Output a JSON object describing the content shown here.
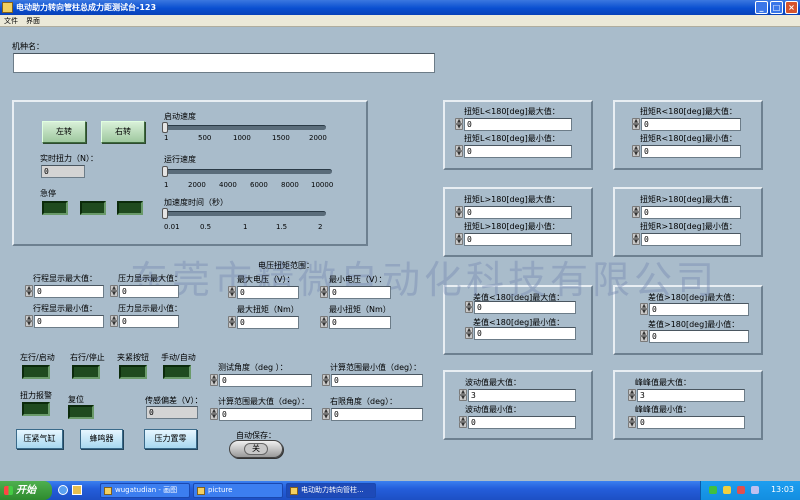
{
  "window": {
    "title": "电动助力转向管柱总成力距测试台-123"
  },
  "menu": [
    "文件",
    "界面"
  ],
  "machine": {
    "label": "机种名：",
    "value": ""
  },
  "control": {
    "left_btn": "左转",
    "right_btn": "右转",
    "torque_label": "实时扭力（N）：",
    "torque_value": "0",
    "estop_label": "急停",
    "start_speed": {
      "label": "启动速度",
      "ticks": [
        "1",
        "500",
        "1000",
        "1500",
        "2000"
      ]
    },
    "run_speed": {
      "label": "运行速度",
      "ticks": [
        "1",
        "2000",
        "4000",
        "6000",
        "8000",
        "10000"
      ]
    },
    "accel_time": {
      "label": "加速度时间（秒）",
      "ticks": [
        "0.01",
        "0.5",
        "1",
        "1.5",
        "2"
      ]
    }
  },
  "limits": [
    {
      "label": "扭矩L<180[deg]最大值：",
      "value": "0"
    },
    {
      "label": "扭矩L<180[deg]最小值：",
      "value": "0"
    },
    {
      "label": "扭矩R<180[deg]最大值：",
      "value": "0"
    },
    {
      "label": "扭矩R<180[deg]最小值：",
      "value": "0"
    },
    {
      "label": "扭矩L>180[deg]最大值：",
      "value": "0"
    },
    {
      "label": "扭矩L>180[deg]最小值：",
      "value": "0"
    },
    {
      "label": "扭矩R>180[deg]最大值：",
      "value": "0"
    },
    {
      "label": "扭矩R>180[deg]最小值：",
      "value": "0"
    },
    {
      "label": "差值<180[deg]最大值：",
      "value": "0"
    },
    {
      "label": "差值<180[deg]最小值：",
      "value": "0"
    },
    {
      "label": "差值>180[deg]最大值：",
      "value": "0"
    },
    {
      "label": "差值>180[deg]最小值：",
      "value": "0"
    },
    {
      "label": "波动值最大值：",
      "value": "3"
    },
    {
      "label": "波动值最小值：",
      "value": "0"
    },
    {
      "label": "峰峰值最大值：",
      "value": "3"
    },
    {
      "label": "峰峰值最小值：",
      "value": "0"
    }
  ],
  "display": [
    {
      "label": "行程显示最大值：",
      "value": "0"
    },
    {
      "label": "压力显示最大值：",
      "value": "0"
    },
    {
      "label": "行程显示最小值：",
      "value": "0"
    },
    {
      "label": "压力显示最小值：",
      "value": "0"
    }
  ],
  "range_title": "电压扭矩范围：",
  "range": [
    {
      "label": "最大电压（V）：",
      "value": "0"
    },
    {
      "label": "最小电压（V）：",
      "value": "0"
    },
    {
      "label": "最大扭矩（Nm）",
      "value": "0"
    },
    {
      "label": "最小扭矩（Nm）",
      "value": "0"
    }
  ],
  "indicators": [
    "左行/启动",
    "右行/停止",
    "夹紧按钮",
    "手动/自动",
    "扭力报警",
    "复位"
  ],
  "angles": [
    {
      "label": "测试角度（deg ）：",
      "value": "0"
    },
    {
      "label": "计算范围最小值（deg）：",
      "value": "0"
    },
    {
      "label": "计算范围最大值（deg）：",
      "value": "0"
    },
    {
      "label": "右限角度（deg）：",
      "value": "0"
    }
  ],
  "sensor": {
    "label": "传感偏差（V）：",
    "value": "0"
  },
  "buttons": {
    "cylinder": "压紧气缸",
    "buzzer": "蜂鸣器",
    "zero": "压力置零"
  },
  "autosave": {
    "label": "自动保存：",
    "state": "关"
  },
  "watermark": "东莞市精微自动化科技有限公司",
  "taskbar": {
    "start": "开始",
    "tasks": [
      "wugatudian - 画图",
      "picture",
      "电动助力转向管柱..."
    ],
    "clock": "13:03"
  },
  "colors": {
    "canvas": "#a9bccb",
    "titlebar": "#0a4fd0",
    "led_off": "#1f4a1f",
    "button_green": "#9fc89f"
  }
}
